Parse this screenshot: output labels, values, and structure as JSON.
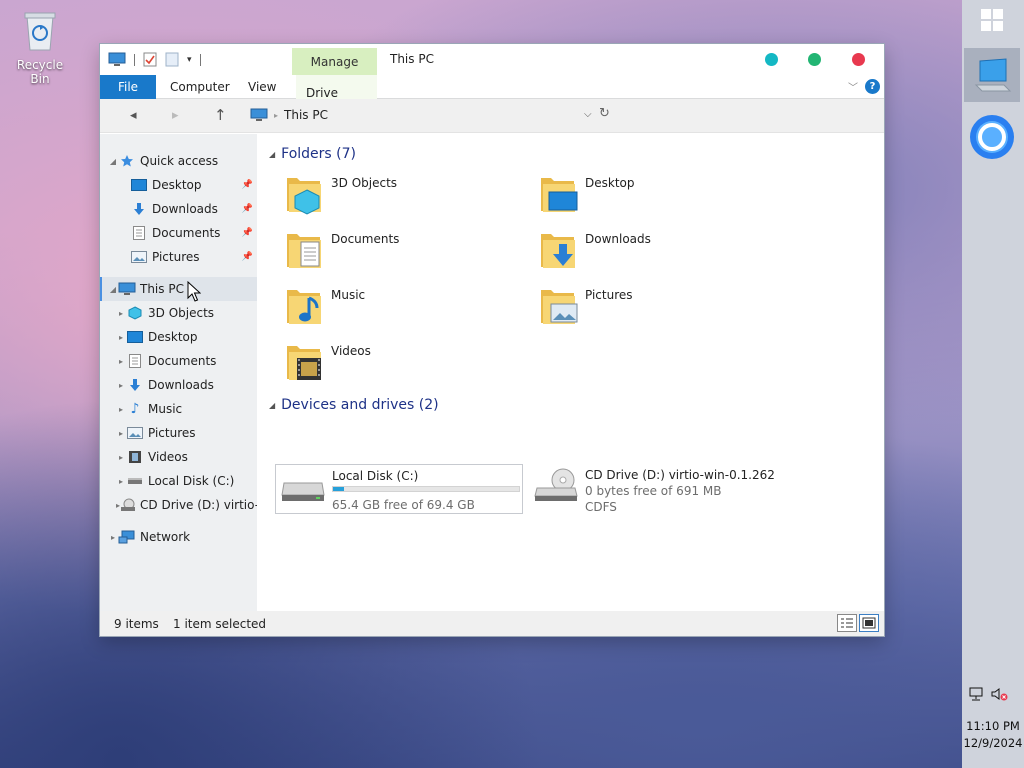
{
  "desktop": {
    "recycle_bin_label": "Recycle Bin"
  },
  "window": {
    "manage_tab": "Manage",
    "title": "This PC",
    "controls": {
      "minimize_color": "#14b8c4",
      "maximize_color": "#22b573",
      "close_color": "#e8394f"
    }
  },
  "ribbon": {
    "tabs": [
      "File",
      "Computer",
      "View",
      "Drive Tools"
    ],
    "help": "?"
  },
  "address": {
    "crumbs": [
      "This PC"
    ]
  },
  "nav": {
    "quick_access": "Quick access",
    "quick_items": [
      "Desktop",
      "Downloads",
      "Documents",
      "Pictures"
    ],
    "this_pc": "This PC",
    "pc_items": [
      "3D Objects",
      "Desktop",
      "Documents",
      "Downloads",
      "Music",
      "Pictures",
      "Videos",
      "Local Disk (C:)",
      "CD Drive (D:) virtio-"
    ],
    "network": "Network"
  },
  "content": {
    "folders_header": "Folders (7)",
    "folders": [
      "3D Objects",
      "Desktop",
      "Documents",
      "Downloads",
      "Music",
      "Pictures",
      "Videos"
    ],
    "devices_header": "Devices and drives (2)",
    "drives": [
      {
        "name": "Local Disk (C:)",
        "free": "65.4 GB free of 69.4 GB",
        "used_fraction": 0.058
      },
      {
        "name": "CD Drive (D:) virtio-win-0.1.262",
        "free": "0 bytes free of 691 MB",
        "fs": "CDFS"
      }
    ]
  },
  "status": {
    "items": "9 items",
    "selected": "1 item selected"
  },
  "taskbar": {
    "time": "11:10 PM",
    "date": "12/9/2024"
  },
  "colors": {
    "accent": "#1979ca",
    "manage_bg": "#d8efc0",
    "header_text": "#1e3287"
  }
}
